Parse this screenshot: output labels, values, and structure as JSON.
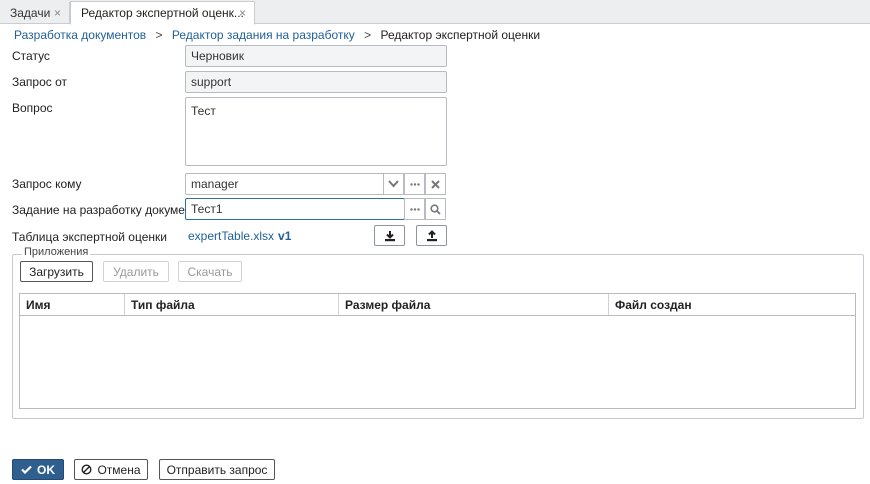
{
  "tabs": [
    {
      "label": "Задачи",
      "close": "×"
    },
    {
      "label": "Редактор экспертной оценк...",
      "close": "×"
    }
  ],
  "breadcrumb": {
    "items": [
      "Разработка документов",
      "Редактор задания на разработку"
    ],
    "separator": ">",
    "current": "Редактор экспертной оценки"
  },
  "form": {
    "status_label": "Статус",
    "status_value": "Черновик",
    "request_from_label": "Запрос от",
    "request_from_value": "support",
    "question_label": "Вопрос",
    "question_value": "Тест",
    "request_to_label": "Запрос кому",
    "request_to_value": "manager",
    "task_label": "Задание на разработку документа",
    "task_value": "Тест1",
    "table_label": "Таблица экспертной оценки",
    "table_file": "expertTable.xlsx",
    "table_version": "v1"
  },
  "attachments": {
    "legend": "Приложения",
    "upload_label": "Загрузить",
    "delete_label": "Удалить",
    "download_label": "Скачать",
    "columns": [
      "Имя",
      "Тип файла",
      "Размер файла",
      "Файл создан"
    ],
    "rows": []
  },
  "footer": {
    "ok_label": "OK",
    "cancel_label": "Отмена",
    "send_label": "Отправить запрос"
  },
  "colors": {
    "link": "#1f5f99",
    "primary": "#2f5f8f"
  }
}
